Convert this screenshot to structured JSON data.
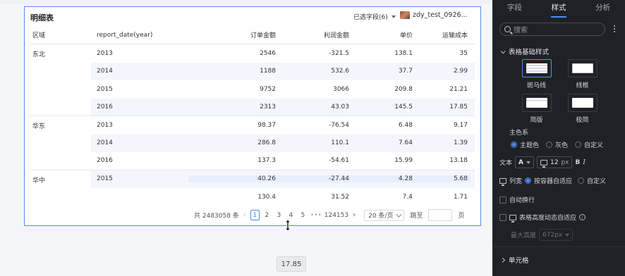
{
  "canvas": {
    "tooltip_value": "17.85"
  },
  "card": {
    "title": "明细表",
    "fields_selected": "已选字段(6)",
    "dataset_name": "zdy_test_0926..."
  },
  "table": {
    "headers": [
      "区域",
      "report_date(year)",
      "订单金额",
      "利润金额",
      "单价",
      "运输成本"
    ],
    "groups": [
      {
        "region": "东北",
        "rows": [
          [
            "2013",
            "2546",
            "-321.5",
            "138.1",
            "35"
          ],
          [
            "2014",
            "1188",
            "532.6",
            "37.7",
            "2.99"
          ],
          [
            "2015",
            "9752",
            "3066",
            "209.8",
            "21.21"
          ],
          [
            "2016",
            "2313",
            "43.03",
            "145.5",
            "17.85"
          ]
        ]
      },
      {
        "region": "华东",
        "rows": [
          [
            "2013",
            "98.37",
            "-76.54",
            "6.48",
            "9.17"
          ],
          [
            "2014",
            "286.8",
            "110.1",
            "7.64",
            "1.39"
          ],
          [
            "2016",
            "137.3",
            "-54.61",
            "15.99",
            "13.18"
          ]
        ]
      },
      {
        "region": "华中",
        "rows": [
          [
            "2015",
            "40.26",
            "-27.44",
            "4.28",
            "5.68"
          ],
          [
            "",
            "130.4",
            "31.52",
            "7.4",
            "1.71"
          ]
        ]
      }
    ]
  },
  "pagination": {
    "total": "共 2483058 条",
    "prev": "‹",
    "pages": [
      "1",
      "2",
      "3",
      "4",
      "5"
    ],
    "current": "1",
    "ellipsis": "•••",
    "last_page": "124153",
    "next": "›",
    "page_size": "20 条/页",
    "jump_label": "跳至",
    "page_suffix": "页"
  },
  "panel": {
    "tabs": [
      "字段",
      "样式",
      "分析"
    ],
    "active_tab": "样式",
    "search_placeholder": "搜索",
    "section_table_style": "表格基础样式",
    "style_options": [
      "斑马线",
      "线框",
      "简版",
      "极简"
    ],
    "main_color_label": "主色系",
    "color_options": [
      "主题色",
      "灰色",
      "自定义"
    ],
    "text_label": "文本",
    "text_style_value": "A",
    "font_size_value": "12",
    "font_size_unit": "px",
    "bold": "B",
    "italic": "I",
    "col_width_label": "列宽",
    "col_width_options": [
      "按容器自适应",
      "自定义"
    ],
    "auto_wrap_label": "自动换行",
    "dynamic_height_label": "表格高度动态自适应",
    "info_glyph": "i",
    "max_height_label": "最大高度",
    "max_height_value": "672px",
    "section_cell": "单元格"
  }
}
